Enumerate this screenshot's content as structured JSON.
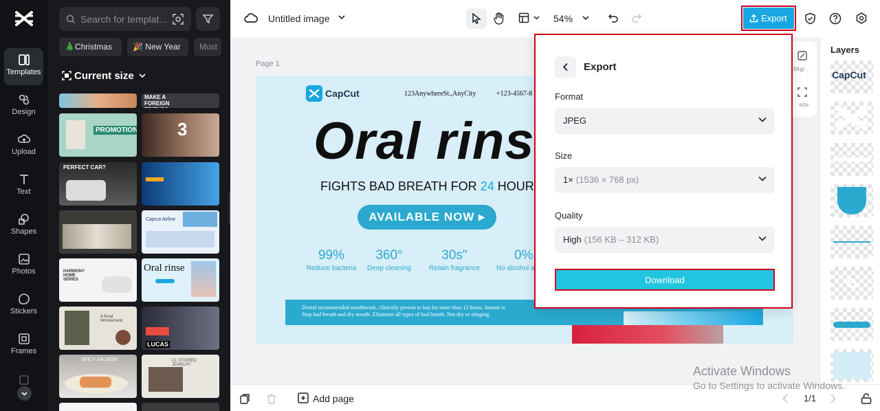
{
  "sidebar": {
    "items": [
      {
        "label": "Templates",
        "icon": "templates-icon",
        "active": true
      },
      {
        "label": "Design",
        "icon": "design-icon"
      },
      {
        "label": "Upload",
        "icon": "upload-icon"
      },
      {
        "label": "Text",
        "icon": "text-icon"
      },
      {
        "label": "Shapes",
        "icon": "shapes-icon"
      },
      {
        "label": "Photos",
        "icon": "photos-icon"
      },
      {
        "label": "Stickers",
        "icon": "stickers-icon"
      },
      {
        "label": "Frames",
        "icon": "frames-icon"
      }
    ]
  },
  "templates": {
    "search_placeholder": "Search for templat...",
    "chips": [
      "Christmas",
      "New Year",
      "Most"
    ],
    "current_size": "Current size",
    "thumb_texts": {
      "t1": "MAKE A FOREIGN FRIEND?",
      "t2": "PROMOTION",
      "t3": "3",
      "t4": "PERFECT CAR?",
      "t5": "Capcut Airline",
      "t6": "HARMONY HOME SERIES",
      "t7": "Oral rinse",
      "t8": "A floral Wonderland",
      "t9": "LUCAS",
      "t10": "SPICY SALMON",
      "t11": "CL STORIED JEWELRY"
    }
  },
  "topbar": {
    "title": "Untitled image",
    "zoom": "54%",
    "export_label": "Export"
  },
  "canvas": {
    "page_label": "Page 1",
    "design": {
      "brand": "CapCut",
      "address": "123AnywhereSt.,AnyCity",
      "phone": "+123-4567-8",
      "headline": "Oral rinse",
      "sub_pre": "FIGHTS BAD BREATH FOR ",
      "sub_num": "24",
      "sub_post": " HOURS",
      "cta": "AVAILABLE NOW ▸",
      "stats": [
        {
          "value": "99%",
          "label": "Reduce bacteria"
        },
        {
          "value": "360°",
          "label": "Deep cleaning"
        },
        {
          "value": "30s\"",
          "label": "Retain fragrance"
        },
        {
          "value": "0%",
          "label": "No alcohol a"
        }
      ],
      "footer_line1": "Dental recommended mouthwash, clinically proven to last for more than 12 hours. Instant re",
      "footer_line2": "Stop bad breath and dry mouth. Eliminate all types of bad breath. Not dry or stinging."
    }
  },
  "side_tools": {
    "bg_label": "Bkgr...",
    "resize_label": "size"
  },
  "layers": {
    "title": "Layers",
    "capcut_text": "CapCut"
  },
  "export_panel": {
    "title": "Export",
    "format_label": "Format",
    "format_value": "JPEG",
    "size_label": "Size",
    "size_value": "1×",
    "size_detail": "(1536 × 768 px)",
    "quality_label": "Quality",
    "quality_value": "High",
    "quality_detail": "(156 KB – 312 KB)",
    "download_label": "Download"
  },
  "bottombar": {
    "add_page_label": "Add page",
    "page_count": "1/1"
  },
  "watermark": {
    "line1": "Activate Windows",
    "line2": "Go to Settings to activate Windows."
  },
  "colors": {
    "accent": "#19a7e2",
    "download": "#22c5e0",
    "highlight": "#d0021b"
  }
}
